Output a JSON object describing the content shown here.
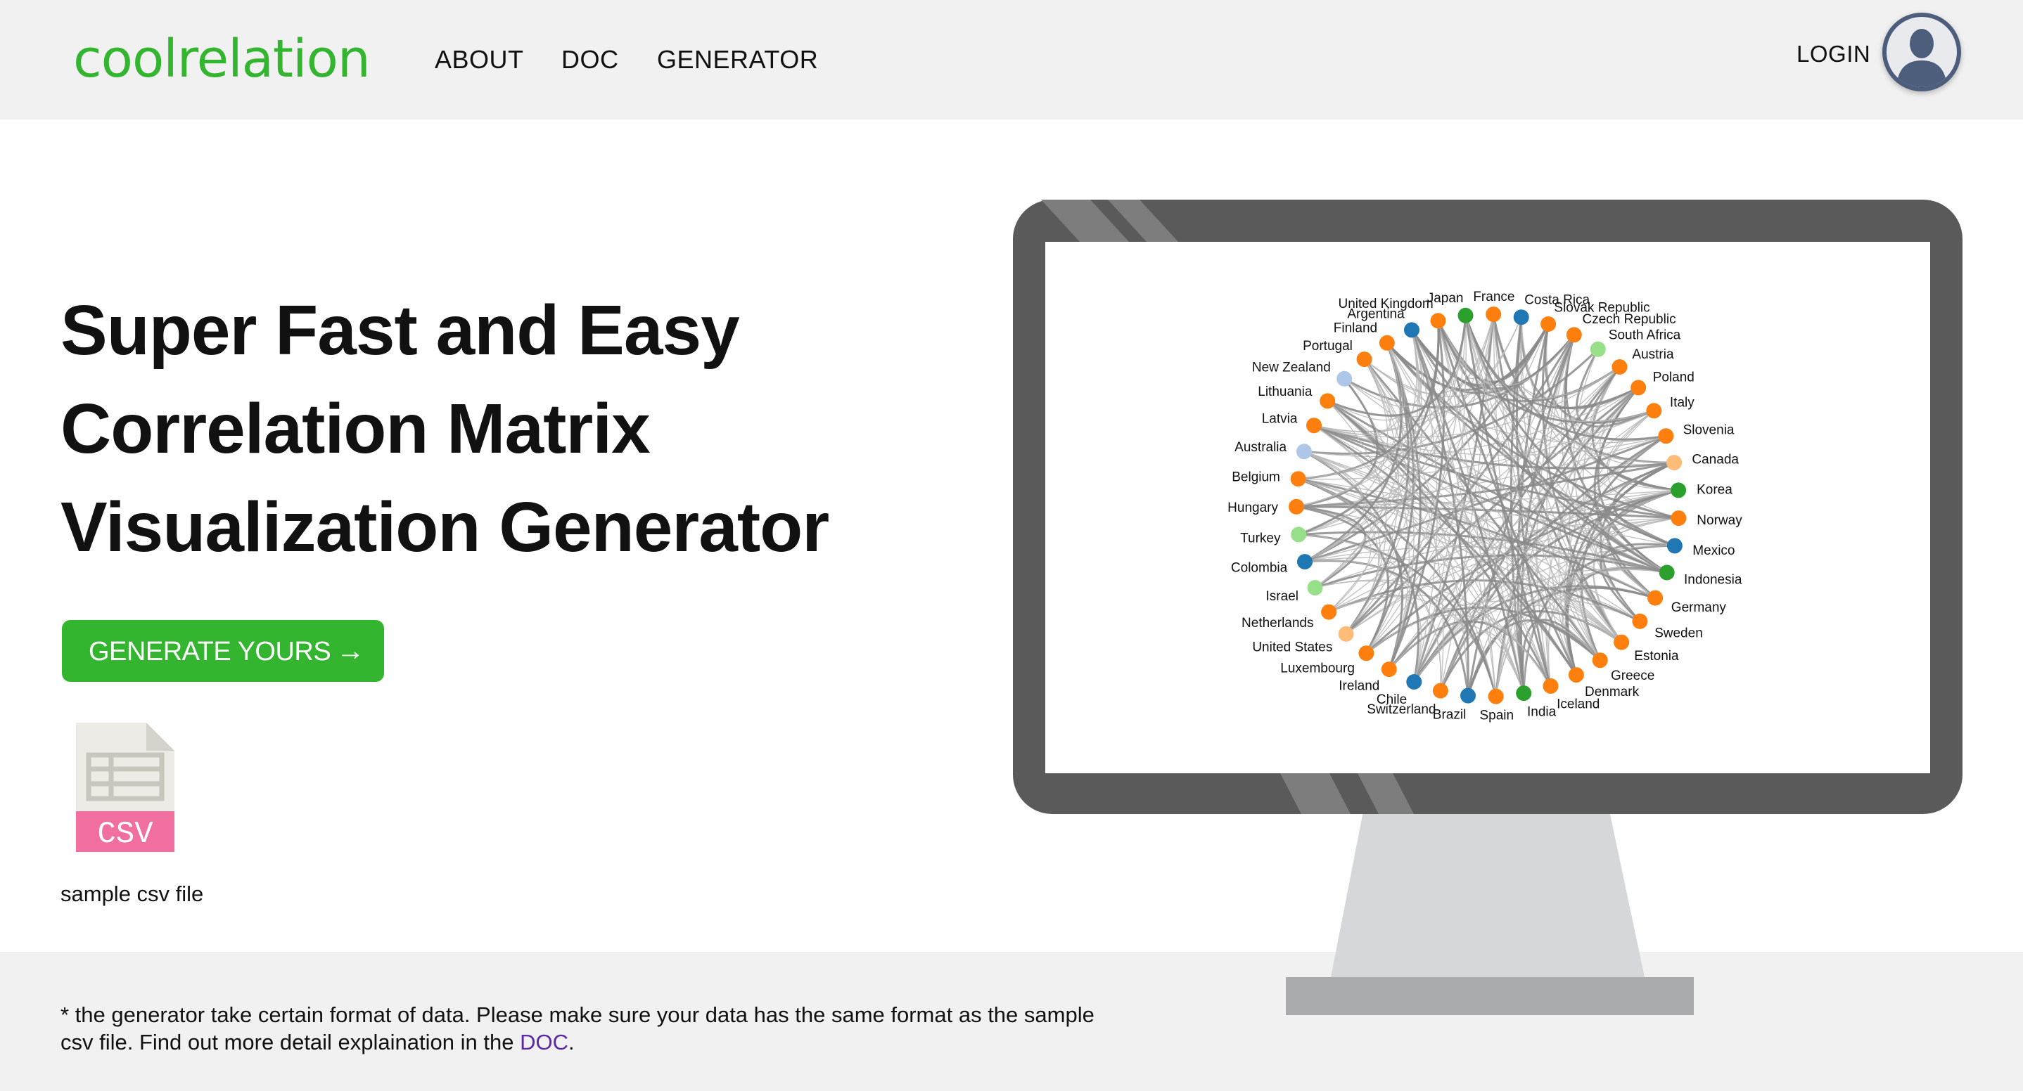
{
  "header": {
    "logo": "coolrelation",
    "nav": [
      "ABOUT",
      "DOC",
      "GENERATOR"
    ],
    "login": "LOGIN",
    "avatar_icon": "user-avatar-icon"
  },
  "hero": {
    "headline": [
      "Super Fast and Easy",
      "Correlation Matrix",
      "Visualization Generator"
    ],
    "button_label": "GENERATE YOURS",
    "button_arrow": "→",
    "csv_icon_label": "CSV",
    "csv_caption": "sample csv file"
  },
  "note": {
    "text": "* the generator take certain format of data. Please make sure your data has the same format as the sample csv file. Find out more detail explaination in the ",
    "link": "DOC",
    "end": "."
  },
  "colors": {
    "brand_green": "#33b52f",
    "header_bg": "#f1f1f1",
    "monitor_frame": "#5a5a5a",
    "stand": "#d6d7db",
    "csv_pink": "#f06ea0"
  },
  "chart_data": {
    "type": "chord-network",
    "nodes": [
      {
        "name": "France",
        "color": "#ff7f0e"
      },
      {
        "name": "Costa Rica",
        "color": "#1f77b4"
      },
      {
        "name": "Slovak Republic",
        "color": "#ff7f0e"
      },
      {
        "name": "Czech Republic",
        "color": "#ff7f0e"
      },
      {
        "name": "South Africa",
        "color": "#98df8a"
      },
      {
        "name": "Austria",
        "color": "#ff7f0e"
      },
      {
        "name": "Poland",
        "color": "#ff7f0e"
      },
      {
        "name": "Italy",
        "color": "#ff7f0e"
      },
      {
        "name": "Slovenia",
        "color": "#ff7f0e"
      },
      {
        "name": "Canada",
        "color": "#ffbb78"
      },
      {
        "name": "Korea",
        "color": "#2ca02c"
      },
      {
        "name": "Norway",
        "color": "#ff7f0e"
      },
      {
        "name": "Mexico",
        "color": "#1f77b4"
      },
      {
        "name": "Indonesia",
        "color": "#2ca02c"
      },
      {
        "name": "Germany",
        "color": "#ff7f0e"
      },
      {
        "name": "Sweden",
        "color": "#ff7f0e"
      },
      {
        "name": "Estonia",
        "color": "#ff7f0e"
      },
      {
        "name": "Greece",
        "color": "#ff7f0e"
      },
      {
        "name": "Denmark",
        "color": "#ff7f0e"
      },
      {
        "name": "Iceland",
        "color": "#ff7f0e"
      },
      {
        "name": "India",
        "color": "#2ca02c"
      },
      {
        "name": "Spain",
        "color": "#ff7f0e"
      },
      {
        "name": "Brazil",
        "color": "#1f77b4"
      },
      {
        "name": "Switzerland",
        "color": "#ff7f0e"
      },
      {
        "name": "Chile",
        "color": "#1f77b4"
      },
      {
        "name": "Ireland",
        "color": "#ff7f0e"
      },
      {
        "name": "Luxembourg",
        "color": "#ff7f0e"
      },
      {
        "name": "United States",
        "color": "#ffbb78"
      },
      {
        "name": "Netherlands",
        "color": "#ff7f0e"
      },
      {
        "name": "Israel",
        "color": "#98df8a"
      },
      {
        "name": "Colombia",
        "color": "#1f77b4"
      },
      {
        "name": "Turkey",
        "color": "#98df8a"
      },
      {
        "name": "Hungary",
        "color": "#ff7f0e"
      },
      {
        "name": "Belgium",
        "color": "#ff7f0e"
      },
      {
        "name": "Australia",
        "color": "#aec7e8"
      },
      {
        "name": "Latvia",
        "color": "#ff7f0e"
      },
      {
        "name": "Lithuania",
        "color": "#ff7f0e"
      },
      {
        "name": "New Zealand",
        "color": "#aec7e8"
      },
      {
        "name": "Portugal",
        "color": "#ff7f0e"
      },
      {
        "name": "Finland",
        "color": "#ff7f0e"
      },
      {
        "name": "Argentina",
        "color": "#1f77b4"
      },
      {
        "name": "United Kingdom",
        "color": "#ff7f0e"
      },
      {
        "name": "Japan",
        "color": "#2ca02c"
      }
    ]
  }
}
